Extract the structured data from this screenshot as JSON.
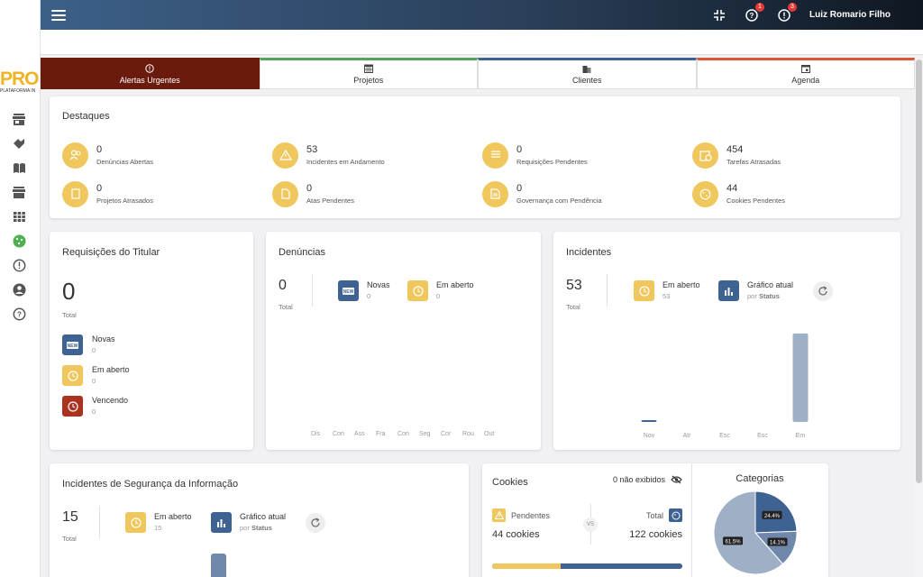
{
  "user": {
    "name": "Luiz Romario Filho"
  },
  "topbar": {
    "badge_help": "1",
    "badge_alert": "3"
  },
  "logo": {
    "text": "PRO",
    "sub": "PLATAFORMA IN"
  },
  "tabs": [
    {
      "label": "Alertas Urgentes",
      "icon": "alert-circle-icon"
    },
    {
      "label": "Projetos",
      "icon": "calendar-grid-icon"
    },
    {
      "label": "Clientes",
      "icon": "building-icon"
    },
    {
      "label": "Agenda",
      "icon": "calendar-icon"
    }
  ],
  "destaques": {
    "title": "Destaques",
    "items": [
      {
        "value": "0",
        "label": "Denúncias Abertas",
        "icon": "people-icon"
      },
      {
        "value": "53",
        "label": "Incidentes em Andamento",
        "icon": "warning-icon"
      },
      {
        "value": "0",
        "label": "Requisições Pendentes",
        "icon": "list-icon"
      },
      {
        "value": "454",
        "label": "Tarefas Atrasadas",
        "icon": "calendar-clock-icon"
      },
      {
        "value": "0",
        "label": "Projetos Atrasados",
        "icon": "book-icon"
      },
      {
        "value": "0",
        "label": "Atas Pendentes",
        "icon": "document-icon"
      },
      {
        "value": "0",
        "label": "Governança com Pendência",
        "icon": "report-icon"
      },
      {
        "value": "44",
        "label": "Cookies Pendentes",
        "icon": "cookie-icon"
      }
    ]
  },
  "requisicoes": {
    "title": "Requisições do Titular",
    "total": "0",
    "total_label": "Total",
    "statuses": [
      {
        "label": "Novas",
        "value": "0",
        "color": "#3e6291"
      },
      {
        "label": "Em aberto",
        "value": "0",
        "color": "#f0c75c"
      },
      {
        "label": "Vencendo",
        "value": "0",
        "color": "#a9331f"
      }
    ]
  },
  "denuncias": {
    "title": "Denúncias",
    "total": "0",
    "total_label": "Total",
    "statuses": [
      {
        "label": "Novas",
        "value": "0"
      },
      {
        "label": "Em aberto",
        "value": "0"
      }
    ],
    "axis": [
      "Dis",
      "Con",
      "Ass",
      "Fra",
      "Con",
      "Seg",
      "Cor",
      "Rou",
      "Out"
    ]
  },
  "incidentes": {
    "title": "Incidentes",
    "total": "53",
    "total_label": "Total",
    "em_aberto_label": "Em aberto",
    "em_aberto_value": "53",
    "grafico_label": "Gráfico atual",
    "grafico_sub_prefix": "por",
    "grafico_sub_bold": "Status",
    "chart_data": {
      "type": "bar",
      "categories": [
        "Nov",
        "Atr",
        "Esc",
        "Esc",
        "Em"
      ],
      "values": [
        1,
        0,
        0,
        0,
        52
      ],
      "ylim": [
        0,
        53
      ],
      "color": "#9fb0c6"
    }
  },
  "seguranca": {
    "title": "Incidentes de Segurança da Informação",
    "total": "15",
    "total_label": "Total",
    "em_aberto_label": "Em aberto",
    "em_aberto_value": "15",
    "grafico_label": "Gráfico atual",
    "grafico_sub_prefix": "por",
    "grafico_sub_bold": "Status"
  },
  "cookies": {
    "title": "Cookies",
    "hidden_text": "0 não exibidos",
    "pendentes_label": "Pendentes",
    "pendentes_value": "44 cookies",
    "vs": "VS",
    "total_label": "Total",
    "total_value": "122 cookies",
    "progress_fraction": 0.36
  },
  "categorias": {
    "title": "Categorias",
    "chart_data": {
      "type": "pie",
      "slices": [
        {
          "label": "24.4%",
          "value": 24.4,
          "color": "#3e6291"
        },
        {
          "label": "14.1%",
          "value": 14.1,
          "color": "#6f88ab"
        },
        {
          "label": "61.5%",
          "value": 61.5,
          "color": "#9fb0c6"
        }
      ]
    }
  }
}
